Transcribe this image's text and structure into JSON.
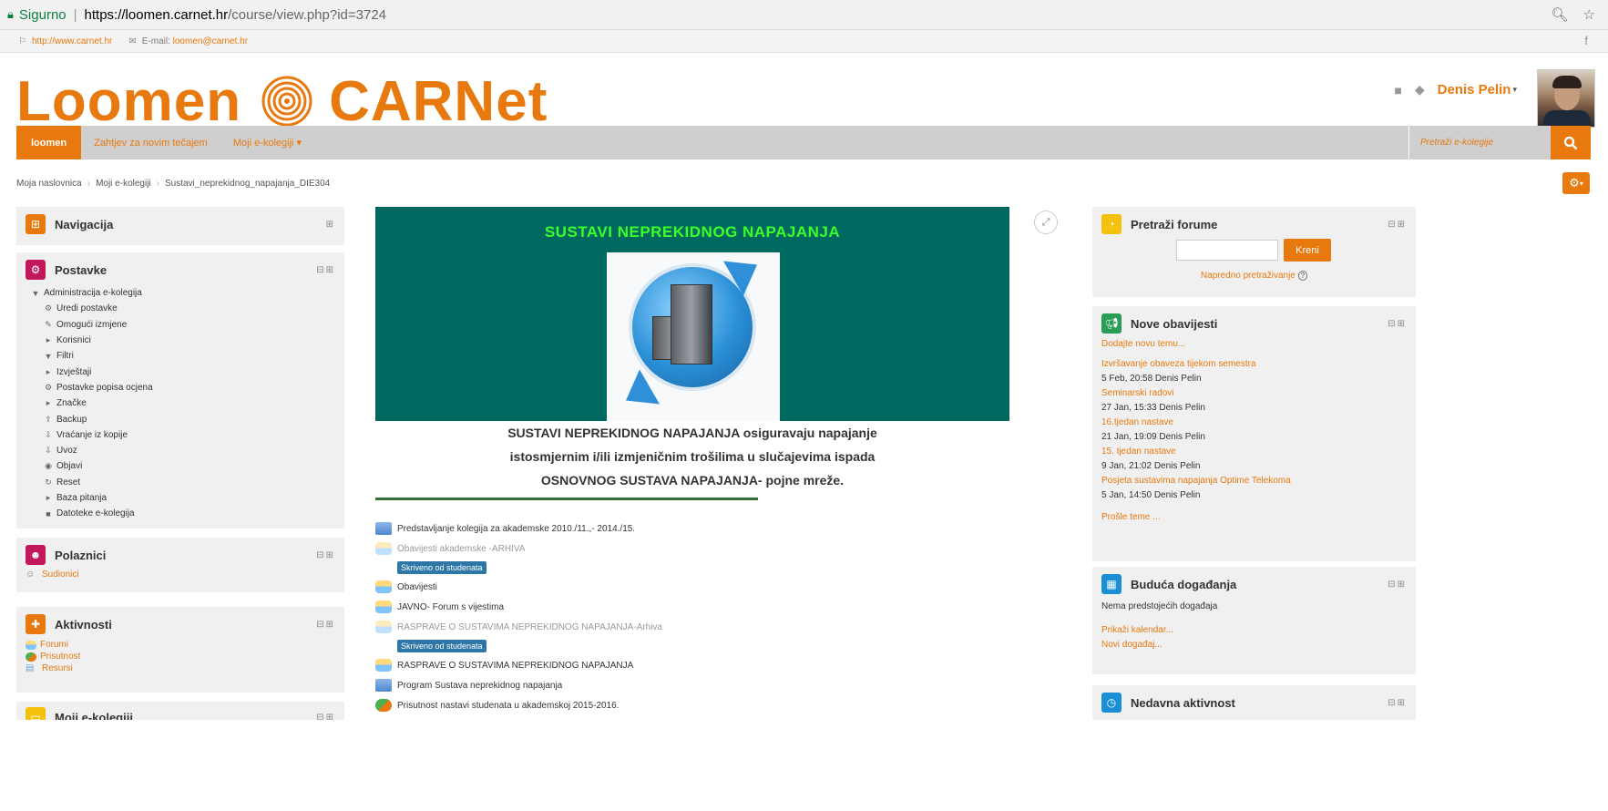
{
  "browser": {
    "secure_label": "Sigurno",
    "url_host": "https://loomen.carnet.hr",
    "url_path": "/course/view.php?id=3724",
    "right_icons": "🔍︎ ☆"
  },
  "topstrip": {
    "website": "http://www.carnet.hr",
    "email_label": "E-mail:",
    "email": "loomen@carnet.hr",
    "facebook": "f"
  },
  "logo": {
    "left": "Loomen",
    "right": "CARNet"
  },
  "user": {
    "name": "Denis Pelin"
  },
  "navbar": {
    "home": "loomen",
    "links": [
      "Zahtjev za novim tečajem",
      "Moji e-kolegiji ▾"
    ],
    "search_placeholder": "Pretraži e-kolegije"
  },
  "breadcrumb": [
    "Moja naslovnica",
    "Moji e-kolegiji",
    "Sustavi_neprekidnog_napajanja_DIE304"
  ],
  "left_blocks": {
    "navigacija": {
      "title": "Navigacija",
      "color": "#e8790e"
    },
    "postavke": {
      "title": "Postavke",
      "color": "#c2185b",
      "root": "Administracija e-kolegija",
      "items": [
        {
          "icon": "⚙",
          "label": "Uredi postavke",
          "expandable": false
        },
        {
          "icon": "✎",
          "label": "Omogući izmjene",
          "expandable": false
        },
        {
          "icon": "▸",
          "label": "Korisnici",
          "expandable": true
        },
        {
          "icon": "▼",
          "label": "Filtri",
          "expandable": false
        },
        {
          "icon": "▸",
          "label": "Izvještaji",
          "expandable": true
        },
        {
          "icon": "⚙",
          "label": "Postavke popisa ocjena",
          "expandable": false
        },
        {
          "icon": "▸",
          "label": "Značke",
          "expandable": true
        },
        {
          "icon": "⇪",
          "label": "Backup",
          "expandable": false
        },
        {
          "icon": "⇩",
          "label": "Vraćanje iz kopije",
          "expandable": false
        },
        {
          "icon": "⇩",
          "label": "Uvoz",
          "expandable": false
        },
        {
          "icon": "◉",
          "label": "Objavi",
          "expandable": false
        },
        {
          "icon": "↻",
          "label": "Reset",
          "expandable": false
        },
        {
          "icon": "▸",
          "label": "Baza pitanja",
          "expandable": true
        },
        {
          "icon": "■",
          "label": "Datoteke e-kolegija",
          "expandable": false
        }
      ]
    },
    "polaznici": {
      "title": "Polaznici",
      "color": "#c2185b",
      "link": "Sudionici"
    },
    "aktivnosti": {
      "title": "Aktivnosti",
      "color": "#e8790e",
      "links": [
        "Forumi",
        "Prisutnost",
        "Resursi"
      ]
    },
    "moji": {
      "title": "Moji e-kolegiji",
      "color": "#f4c20d"
    }
  },
  "banner": {
    "heading": "SUSTAVI NEPREKIDNOG NAPAJANJA",
    "lines": [
      "SUSTAVI NEPREKIDNOG NAPAJANJA osiguravaju napajanje",
      "istosmjernim i/ili izmjeničnim trošilima u slučajevima ispada",
      "OSNOVNOG SUSTAVA NAPAJANJA- pojne mreže."
    ]
  },
  "activities": [
    {
      "type": "folder",
      "label": "Predstavljanje kolegija za akademske 2010./11.,- 2014./15.",
      "hidden": false
    },
    {
      "type": "forum",
      "label": "Obavijesti akademske -ARHIVA",
      "hidden": true
    },
    {
      "type": "forum",
      "label": "Obavijesti",
      "hidden": false
    },
    {
      "type": "forum",
      "label": "JAVNO- Forum s vijestima",
      "hidden": false
    },
    {
      "type": "forum",
      "label": "RASPRAVE O SUSTAVIMA NEPREKIDNOG NAPAJANJA-Arhiva",
      "hidden": true
    },
    {
      "type": "forum",
      "label": "RASPRAVE O SUSTAVIMA NEPREKIDNOG NAPAJANJA",
      "hidden": false
    },
    {
      "type": "folder",
      "label": "Program Sustava neprekidnog napajanja",
      "hidden": false
    },
    {
      "type": "attendance",
      "label": "Prisutnost nastavi studenata u akademskoj 2015-2016.",
      "hidden": false
    }
  ],
  "hidden_badge": "Skriveno od studenata",
  "right_blocks": {
    "search": {
      "title": "Pretraži forume",
      "color": "#f4c20d",
      "button": "Kreni",
      "advanced": "Napredno pretraživanje"
    },
    "news": {
      "title": "Nove obavijesti",
      "color": "#2a9d55",
      "add": "Dodajte novu temu...",
      "posts": [
        {
          "title": "Izvršavanje obaveza tijekom semestra",
          "meta": "5 Feb, 20:58  Denis Pelin"
        },
        {
          "title": "Seminarski radovi",
          "meta": "27 Jan, 15:33  Denis Pelin"
        },
        {
          "title": "16.tjedan nastave",
          "meta": "21 Jan, 19:09  Denis Pelin"
        },
        {
          "title": "15. tjedan nastave",
          "meta": "9 Jan, 21:02  Denis Pelin"
        },
        {
          "title": "Posjeta sustavima napajanja Optime Telekoma",
          "meta": "5 Jan, 14:50  Denis Pelin"
        }
      ],
      "older": "Prošle teme ..."
    },
    "events": {
      "title": "Buduća događanja",
      "color": "#1a8fd6",
      "none": "Nema predstojećih događaja",
      "calendar": "Prikaži kalendar...",
      "new": "Novi događaj..."
    },
    "recent": {
      "title": "Nedavna aktivnost",
      "color": "#1a8fd6"
    }
  }
}
